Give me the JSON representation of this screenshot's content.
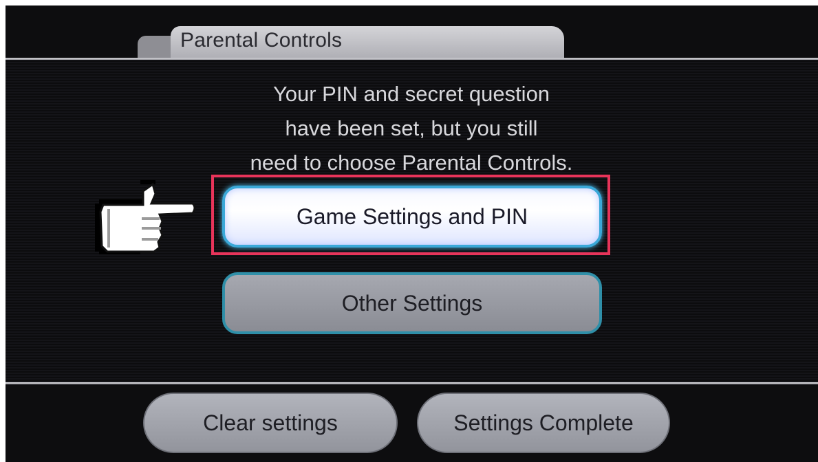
{
  "tab": {
    "title": "Parental Controls"
  },
  "message": {
    "lines": [
      "Your PIN and secret question",
      "have been set, but you still",
      "need to choose Parental Controls."
    ]
  },
  "buttons": {
    "game_settings": "Game Settings and PIN",
    "other_settings": "Other Settings",
    "clear_settings": "Clear settings",
    "settings_complete": "Settings Complete"
  },
  "pointer": {
    "icon": "hand-pointer-icon"
  },
  "colors": {
    "highlight": "#e8345a",
    "selected_border": "#3aa8d8",
    "background": "#0d0d0f"
  }
}
